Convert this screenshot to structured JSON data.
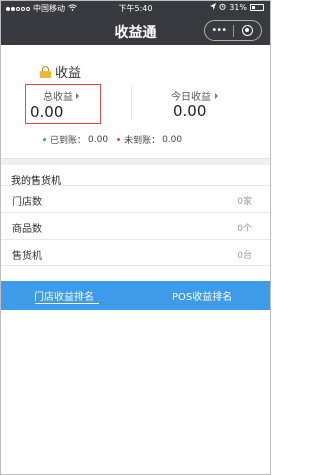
{
  "status_bar": {
    "carrier": "中国移动",
    "wifi": "wifi-icon",
    "time": "下午5:40",
    "battery": "31%",
    "signal_bars_full": 2,
    "signal_bars_total": 5
  },
  "nav": {
    "title": "收益通",
    "more_label": "•••"
  },
  "earnings": {
    "title": "收益",
    "total_label": "总收益",
    "total_value": "0.00",
    "today_label": "今日收益",
    "today_value": "0.00",
    "arrived_label": "已到账：",
    "arrived_value": "0.00",
    "pending_label": "未到账：",
    "pending_value": "0.00"
  },
  "machines": {
    "title": "我的售货机",
    "rows": [
      {
        "label": "门店数",
        "value": "0家"
      },
      {
        "label": "商品数",
        "value": "0个"
      },
      {
        "label": "售货机",
        "value": "0台"
      }
    ]
  },
  "tabs": {
    "store_rank": "门店收益排名",
    "pos_rank": "POS收益排名"
  },
  "colors": {
    "nav_bg": "#393a3f",
    "tab_bg": "#3d9be9",
    "highlight_border": "#e24b3b",
    "arrived_dot": "#2cb34a",
    "pending_dot": "#e24b3b"
  }
}
